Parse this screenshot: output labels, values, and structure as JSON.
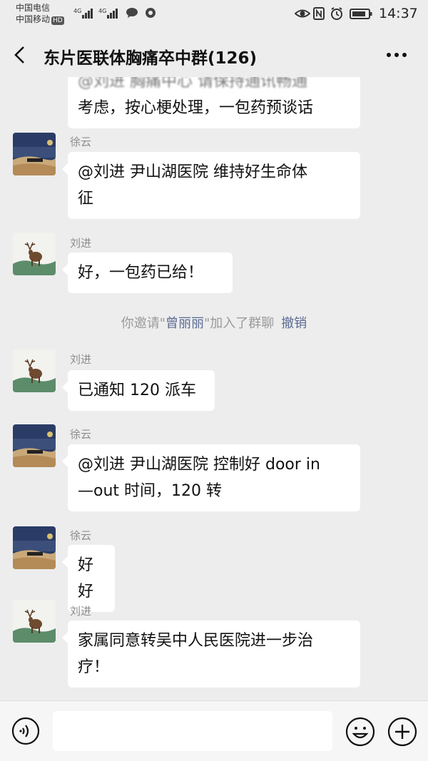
{
  "status_bar": {
    "carrier1": "中国电信",
    "carrier2": "中国移动",
    "hd": "HD",
    "net1": "4G",
    "net2": "4G",
    "time": "14:37"
  },
  "header": {
    "title": "东片医联体胸痛卒中群(126)"
  },
  "messages": [
    {
      "sender": "",
      "lines": [
        "考虑，按心梗处理，一包药预谈话"
      ]
    },
    {
      "sender": "徐云",
      "lines": [
        "@刘进  尹山湖医院  维持好生命体",
        "征"
      ]
    },
    {
      "sender": "刘进",
      "lines": [
        "好，一包药已给！"
      ]
    },
    {
      "sender": "刘进",
      "lines": [
        "已通知 120 派车"
      ]
    },
    {
      "sender": "徐云",
      "lines": [
        "@刘进  尹山湖医院  控制好 door in",
        "—out 时间，120 转"
      ]
    },
    {
      "sender": "徐云",
      "lines": [
        "好好"
      ]
    },
    {
      "sender": "刘进",
      "lines": [
        "家属同意转吴中人民医院进一步治",
        "疗！"
      ]
    }
  ],
  "system_message": {
    "prefix": "你邀请\"",
    "name": "曾丽丽",
    "suffix": "\"加入了群聊",
    "action": "撤销"
  },
  "input": {
    "value": ""
  },
  "colors": {
    "background": "#ededed",
    "bubble": "#ffffff",
    "link": "#5b6b93"
  }
}
